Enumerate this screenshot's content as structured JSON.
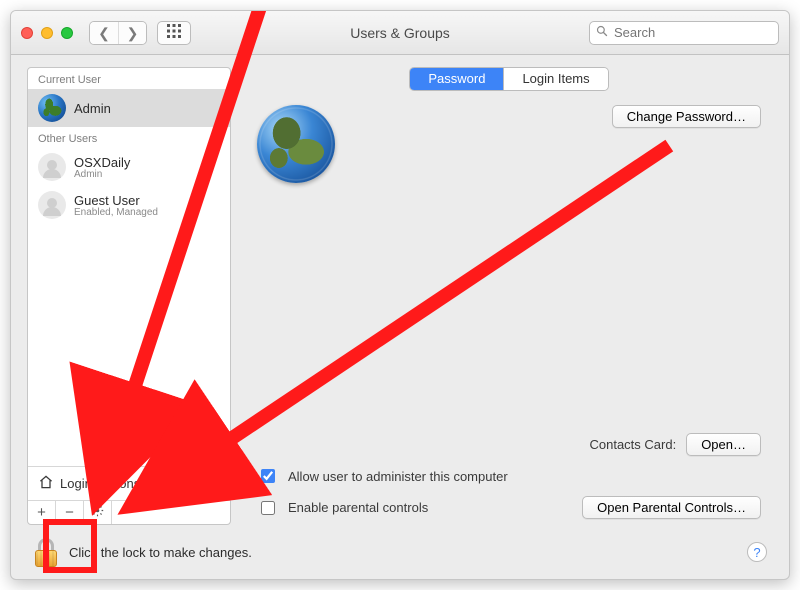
{
  "window": {
    "title": "Users & Groups"
  },
  "search": {
    "placeholder": "Search"
  },
  "sidebar": {
    "sections": {
      "current_label": "Current User",
      "other_label": "Other Users"
    },
    "current": {
      "name": "Admin"
    },
    "others": [
      {
        "name": "OSXDaily",
        "sub": "Admin"
      },
      {
        "name": "Guest User",
        "sub": "Enabled, Managed"
      }
    ],
    "login_options": "Login Options"
  },
  "tabs": {
    "password": "Password",
    "login_items": "Login Items"
  },
  "main": {
    "change_password": "Change Password…",
    "contacts_label": "Contacts Card:",
    "open": "Open…",
    "admin_check": "Allow user to administer this computer",
    "parental_check": "Enable parental controls",
    "open_parental": "Open Parental Controls…"
  },
  "footer": {
    "lock_text": "Click the lock to make changes."
  }
}
